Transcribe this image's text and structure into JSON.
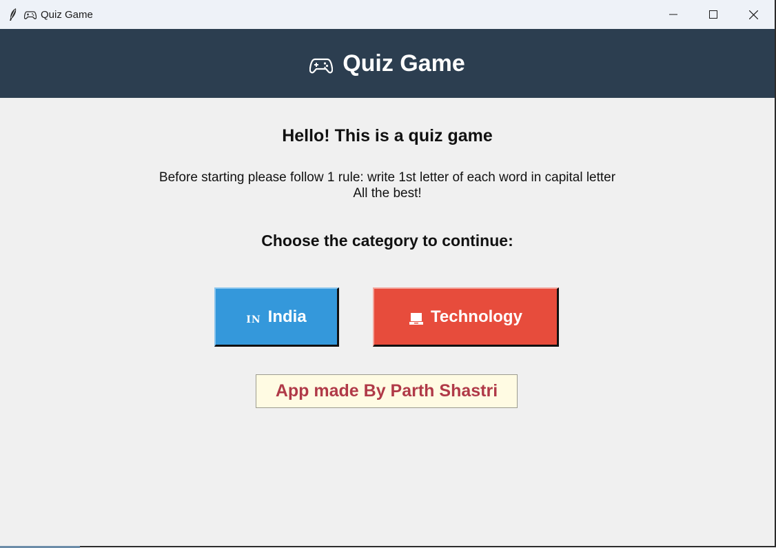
{
  "window": {
    "title": "Quiz Game",
    "app_icon": "feather-icon",
    "title_icon": "gamepad-icon",
    "controls": [
      "minimize",
      "maximize",
      "close"
    ]
  },
  "header": {
    "icon": "gamepad-icon",
    "title": "Quiz Game",
    "background": "#2c3e50"
  },
  "main": {
    "greeting": "Hello! This is a quiz game",
    "rule_line1": "Before starting please follow 1 rule: write 1st letter of each word in capital letter",
    "rule_line2": "All the best!",
    "choose_label": "Choose the category to continue:"
  },
  "categories": [
    {
      "icon_text": "IN",
      "icon": "india-flag-letters-icon",
      "label": "India",
      "color": "#3498db"
    },
    {
      "icon": "laptop-icon",
      "label": "Technology",
      "color": "#e74c3c"
    }
  ],
  "credit": {
    "text": "App made By Parth Shastri",
    "color": "#b03a48",
    "background": "#fffbe3"
  }
}
